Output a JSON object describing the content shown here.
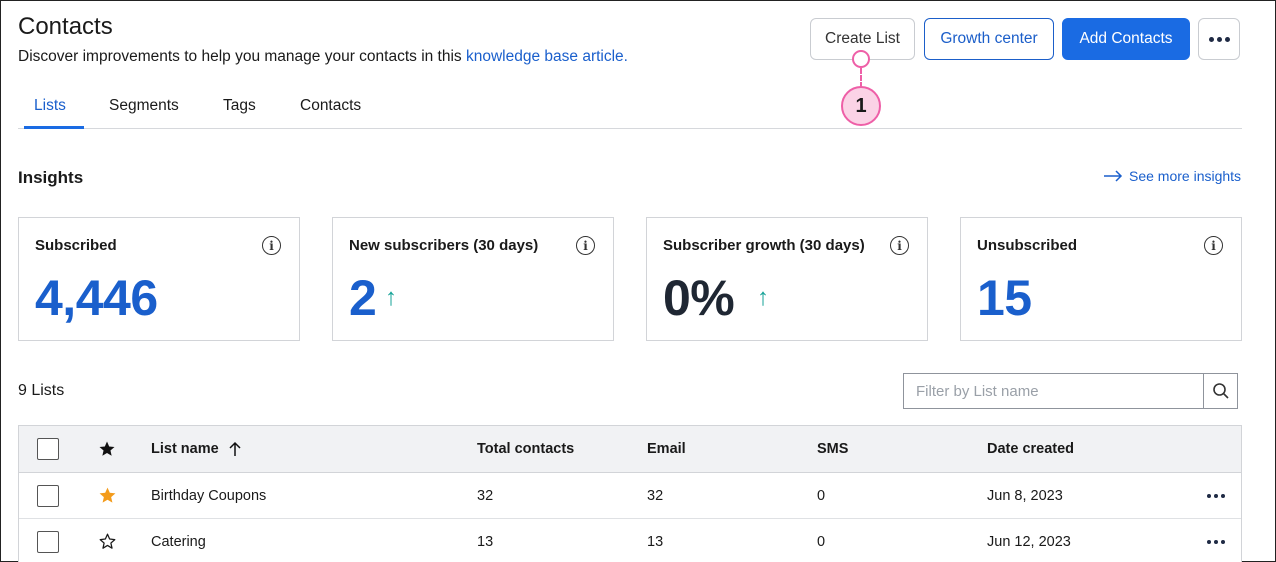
{
  "header": {
    "title": "Contacts",
    "subtitle_text": "Discover improvements to help you manage your contacts in this ",
    "subtitle_link": "knowledge base article."
  },
  "actions": {
    "create_list": "Create List",
    "growth_center": "Growth center",
    "add_contacts": "Add Contacts",
    "more_icon": "more-horizontal-icon"
  },
  "callout": {
    "number": "1"
  },
  "tabs": [
    {
      "label": "Lists",
      "active": true
    },
    {
      "label": "Segments",
      "active": false
    },
    {
      "label": "Tags",
      "active": false
    },
    {
      "label": "Contacts",
      "active": false
    }
  ],
  "insights": {
    "title": "Insights",
    "see_more": "See more insights",
    "cards": [
      {
        "label": "Subscribed",
        "value": "4,446",
        "trend": ""
      },
      {
        "label": "New subscribers (30 days)",
        "value": "2",
        "trend": "↑"
      },
      {
        "label": "Subscriber growth (30 days)",
        "value": "0%",
        "trend": "↑"
      },
      {
        "label": "Unsubscribed",
        "value": "15",
        "trend": ""
      }
    ]
  },
  "lists": {
    "count_label": "9 Lists",
    "filter_placeholder": "Filter by List name",
    "columns": {
      "list_name": "List name",
      "total_contacts": "Total contacts",
      "email": "Email",
      "sms": "SMS",
      "date_created": "Date created"
    },
    "rows": [
      {
        "starred": true,
        "name": "Birthday Coupons",
        "total": "32",
        "email": "32",
        "sms": "0",
        "date": "Jun 8, 2023"
      },
      {
        "starred": false,
        "name": "Catering",
        "total": "13",
        "email": "13",
        "sms": "0",
        "date": "Jun 12, 2023"
      }
    ]
  },
  "colors": {
    "primary": "#1a6be3",
    "link": "#1a5fcc",
    "trend_up": "#17a398",
    "star": "#f39b1b",
    "callout": "#ee5fa7"
  }
}
